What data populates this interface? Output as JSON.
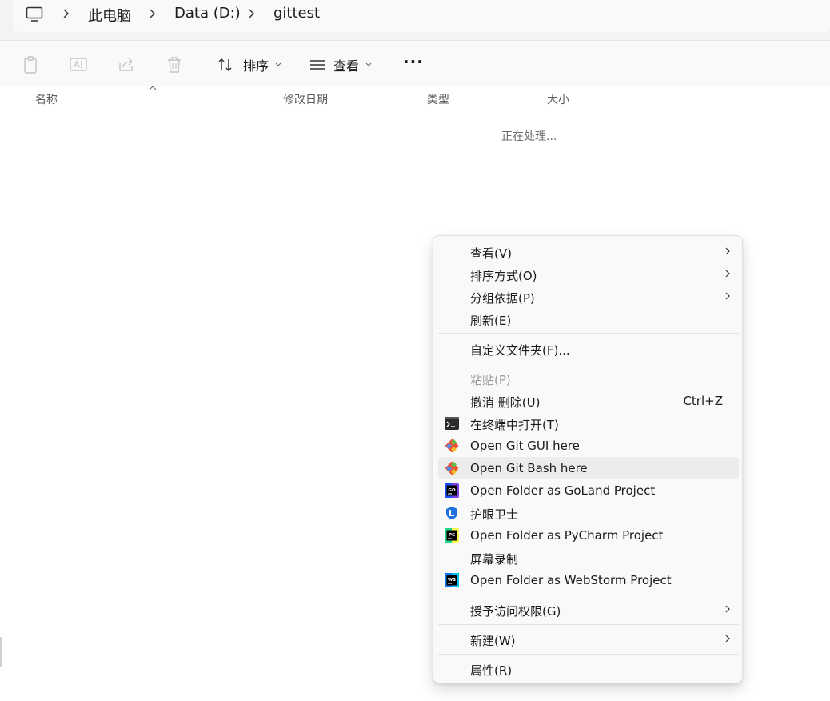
{
  "breadcrumb": {
    "root_icon": "this-pc-icon",
    "items": [
      "此电脑",
      "Data (D:)",
      "gittest"
    ]
  },
  "toolbar": {
    "sort_label": "排序",
    "view_label": "查看",
    "more_label": "···",
    "icons": [
      "paste-icon",
      "rename-icon",
      "share-icon",
      "delete-icon",
      "sort-icon",
      "view-icon",
      "more-icon"
    ]
  },
  "columns": {
    "name": "名称",
    "modified": "修改日期",
    "type": "类型",
    "size": "大小"
  },
  "status": {
    "processing": "正在处理..."
  },
  "context_menu": {
    "view": "查看(V)",
    "sort_by": "排序方式(O)",
    "group_by": "分组依据(P)",
    "refresh": "刷新(E)",
    "customize": "自定义文件夹(F)...",
    "paste": "粘贴(P)",
    "undo_delete": "撤消 删除(U)",
    "undo_shortcut": "Ctrl+Z",
    "open_terminal": "在终端中打开(T)",
    "git_gui": "Open Git GUI here",
    "git_bash": "Open Git Bash here",
    "goland": "Open Folder as GoLand Project",
    "eye_guard": "护眼卫士",
    "pycharm": "Open Folder as PyCharm Project",
    "screen_record": "屏幕录制",
    "webstorm": "Open Folder as WebStorm Project",
    "grant_access": "授予访问权限(G)",
    "new": "新建(W)",
    "properties": "属性(R)"
  },
  "colors": {
    "menu_bg": "#f9f9f9",
    "hover_bg": "#ececec",
    "disabled_text": "#9a9a9a",
    "git_orange": "#f05133",
    "goland_accent": "#1a4fff",
    "pycharm_accent": "#21d789",
    "webstorm_accent": "#07c3f2"
  }
}
